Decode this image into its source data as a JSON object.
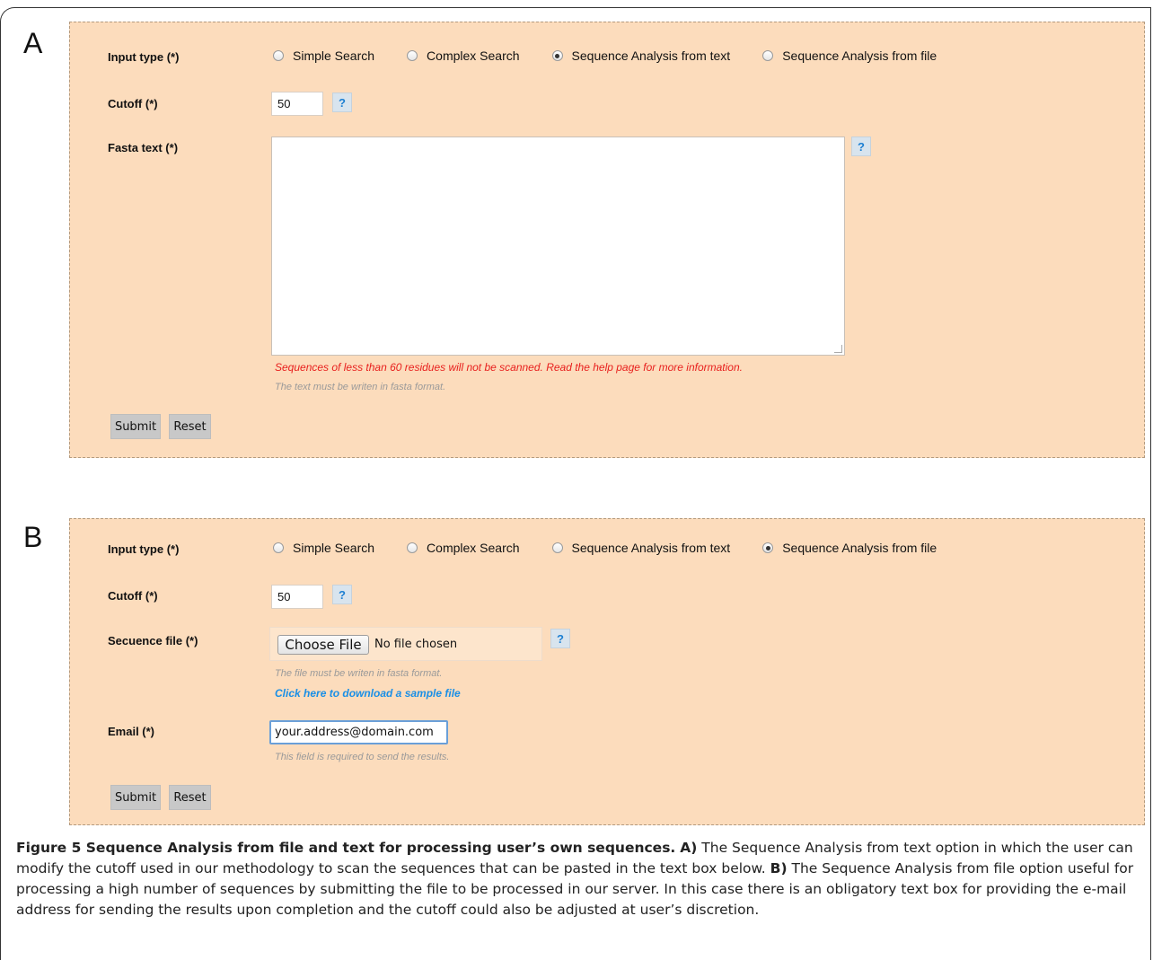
{
  "panels": {
    "a": {
      "letter": "A",
      "input_type_label": "Input type (*)",
      "radio_options": [
        "Simple Search",
        "Complex Search",
        "Sequence Analysis from text",
        "Sequence Analysis from file"
      ],
      "selected_index": 2,
      "cutoff_label": "Cutoff (*)",
      "cutoff_value": "50",
      "help_label": "?",
      "fasta_label": "Fasta text (*)",
      "fasta_value": "",
      "warning": "Sequences of less than 60 residues will not be scanned. Read the help page for more information.",
      "format_note": "The text must be writen in fasta format.",
      "submit_label": "Submit",
      "reset_label": "Reset"
    },
    "b": {
      "letter": "B",
      "input_type_label": "Input type (*)",
      "radio_options": [
        "Simple Search",
        "Complex Search",
        "Sequence Analysis from text",
        "Sequence Analysis from file"
      ],
      "selected_index": 3,
      "cutoff_label": "Cutoff (*)",
      "cutoff_value": "50",
      "help_label": "?",
      "file_label": "Secuence file (*)",
      "choose_file_label": "Choose File",
      "file_status": "No file chosen",
      "format_note": "The file must be writen in fasta format.",
      "sample_link": "Click here to download a sample file",
      "email_label": "Email (*)",
      "email_value": "your.address@domain.com",
      "email_note": "This field is required to send the results.",
      "submit_label": "Submit",
      "reset_label": "Reset"
    }
  },
  "caption": {
    "figure_title": "Figure 5 Sequence Analysis from file and text for processing user’s own sequences.",
    "part_a_marker": "A)",
    "part_a_text": "The Sequence Analysis from text option in which the user can modify the cutoff used in our methodology to scan the sequences that can be pasted in the text box below.",
    "part_b_marker": "B)",
    "part_b_text": "The Sequence Analysis from file option useful for processing a high number of sequences by submitting the file to be processed in our server. In this case there is an obligatory text box for providing the e-mail address for sending the results upon completion and the cutoff could also be adjusted at user’s discretion."
  },
  "colors": {
    "panel_bg": "#fcdcbc",
    "warning_red": "#e8201e",
    "link_blue": "#1a8fe6",
    "help_blue": "#1c7fd2"
  }
}
